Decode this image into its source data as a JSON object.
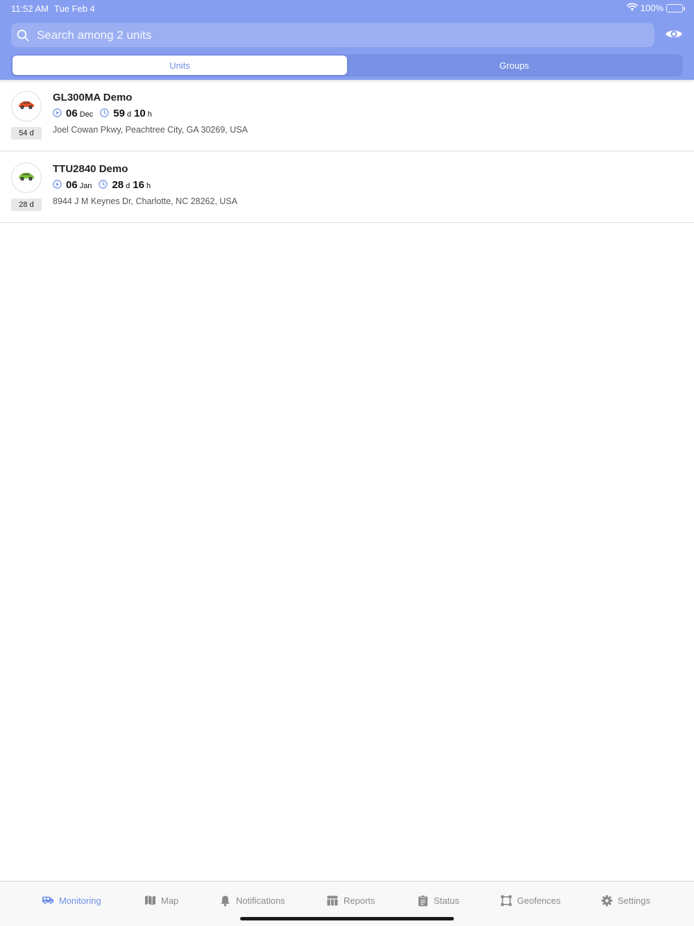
{
  "status_bar": {
    "time": "11:52 AM",
    "date": "Tue Feb 4",
    "battery": "100%"
  },
  "search": {
    "placeholder": "Search among 2 units"
  },
  "segments": [
    {
      "label": "Units",
      "active": true
    },
    {
      "label": "Groups",
      "active": false
    }
  ],
  "units": [
    {
      "name": "GL300MA Demo",
      "age": "54 d",
      "car_color": "#e4502a",
      "start_day": "06",
      "start_month": "Dec",
      "duration_days": "59",
      "duration_days_unit": "d",
      "duration_hours": "10",
      "duration_hours_unit": "h",
      "address": "Joel Cowan Pkwy, Peachtree City, GA 30269, USA"
    },
    {
      "name": "TTU2840 Demo",
      "age": "28 d",
      "car_color": "#7fc23a",
      "start_day": "06",
      "start_month": "Jan",
      "duration_days": "28",
      "duration_days_unit": "d",
      "duration_hours": "16",
      "duration_hours_unit": "h",
      "address": "8944 J M Keynes Dr, Charlotte, NC 28262, USA"
    }
  ],
  "tabs": [
    {
      "label": "Monitoring",
      "icon": "van-icon",
      "active": true
    },
    {
      "label": "Map",
      "icon": "map-icon",
      "active": false
    },
    {
      "label": "Notifications",
      "icon": "bell-icon",
      "active": false
    },
    {
      "label": "Reports",
      "icon": "table-icon",
      "active": false
    },
    {
      "label": "Status",
      "icon": "clipboard-icon",
      "active": false
    },
    {
      "label": "Geofences",
      "icon": "geofence-icon",
      "active": false
    },
    {
      "label": "Settings",
      "icon": "gear-icon",
      "active": false
    }
  ],
  "colors": {
    "header": "#869ef0",
    "accent": "#6f8fe9"
  }
}
